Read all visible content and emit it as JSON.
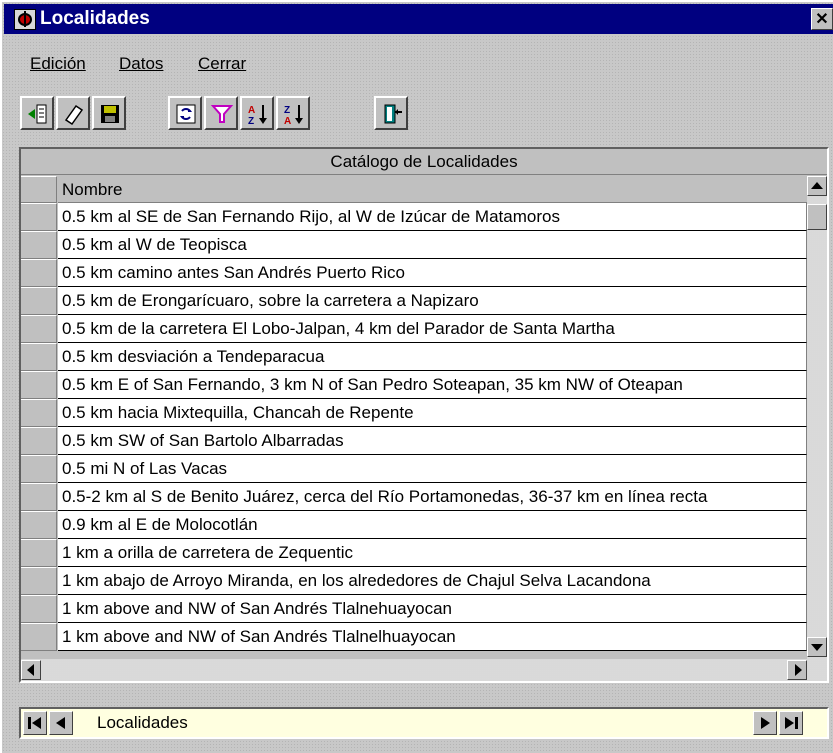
{
  "window": {
    "title": "Localidades",
    "close_glyph": "✕",
    "icon": "bug-icon"
  },
  "menu": {
    "items": [
      {
        "label": "Edición"
      },
      {
        "label": "Datos"
      },
      {
        "label": "Cerrar"
      }
    ]
  },
  "toolbar": {
    "buttons": [
      {
        "icon": "new-record-icon"
      },
      {
        "icon": "eraser-icon"
      },
      {
        "icon": "save-icon"
      },
      {
        "icon": "refresh-icon"
      },
      {
        "icon": "filter-icon"
      },
      {
        "icon": "sort-ascending-icon"
      },
      {
        "icon": "sort-descending-icon"
      },
      {
        "icon": "exit-icon"
      }
    ]
  },
  "grid": {
    "caption": "Catálogo de Localidades",
    "column_header": "Nombre",
    "rows": [
      "0.5 km al SE de San Fernando Rijo, al W de Izúcar de Matamoros",
      "0.5 km al W de Teopisca",
      "0.5 km camino antes San Andrés Puerto Rico",
      "0.5 km de Erongarícuaro, sobre la carretera a Napizaro",
      "0.5 km de la carretera El Lobo-Jalpan, 4 km del Parador de Santa Martha",
      "0.5 km desviación a Tendeparacua",
      "0.5 km E of San Fernando, 3 km N of San Pedro Soteapan, 35 km NW of Oteapan",
      "0.5 km hacia Mixtequilla, Chancah de Repente",
      "0.5 km SW of San Bartolo Albarradas",
      "0.5 mi N of Las Vacas",
      "0.5-2 km al S de Benito Juárez, cerca del Río Portamonedas, 36-37 km en línea recta",
      "0.9 km al E de Molocotlán",
      "1 km a orilla de carretera de Zequentic",
      "1 km abajo de Arroyo Miranda, en los alrededores de Chajul Selva Lacandona",
      "1 km above and NW of San Andrés Tlalnehuayocan",
      "1 km above and NW of San Andrés Tlalnelhuayocan"
    ]
  },
  "navigator": {
    "label": "Localidades"
  },
  "colors": {
    "title_bar": "#000080",
    "face": "#c0c0c0",
    "navigator_bg": "#ffffe0"
  }
}
